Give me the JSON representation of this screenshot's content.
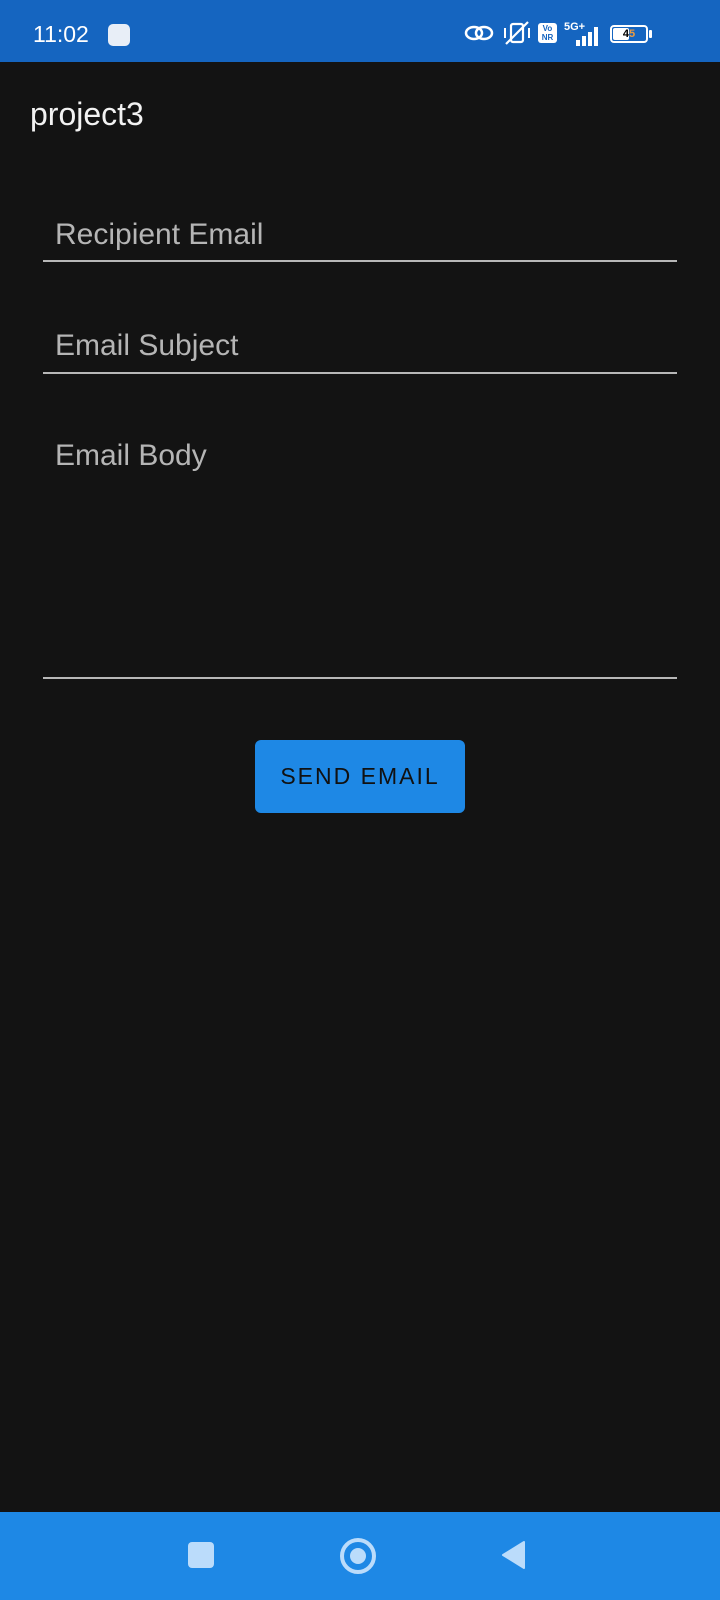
{
  "status_bar": {
    "time": "11:02",
    "network": "5G+",
    "volte": "Vo NR",
    "battery": "45",
    "icons": [
      "app-notification-icon",
      "link-icon",
      "vibrate-off-icon",
      "volte-icon",
      "signal-icon",
      "battery-icon"
    ]
  },
  "app_bar": {
    "title": "project3"
  },
  "form": {
    "recipient_placeholder": "Recipient Email",
    "subject_placeholder": "Email Subject",
    "body_placeholder": "Email Body",
    "send_label": "SEND EMAIL"
  },
  "nav_bar": {
    "icons": [
      "recents-icon",
      "home-icon",
      "back-icon"
    ]
  },
  "colors": {
    "status_bar": "#1565C0",
    "background": "#131313",
    "button": "#1E88E5",
    "nav_bar": "#1E88E5"
  }
}
